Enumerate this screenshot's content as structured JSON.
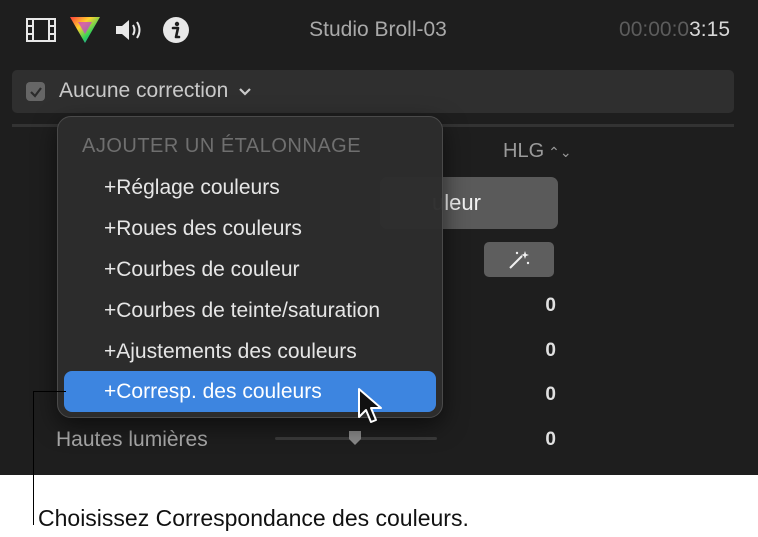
{
  "toolbar": {
    "icons": [
      "film-icon",
      "color-inspector-icon",
      "audio-icon",
      "info-icon"
    ],
    "clip_title": "Studio Broll-03",
    "timecode_dim": "00:00:0",
    "timecode_bright": "3:15"
  },
  "correction": {
    "checked": true,
    "label": "Aucune correction"
  },
  "background": {
    "hlg_label": "HLG",
    "couleur_button_label": "uleur",
    "values": [
      "0",
      "0",
      "0",
      "0"
    ],
    "highlights_label": "Hautes lumières",
    "highlights_slider": 0.5
  },
  "menu": {
    "header": "AJOUTER UN ÉTALONNAGE",
    "items": [
      "+Réglage couleurs",
      "+Roues des couleurs",
      "+Courbes de couleur",
      "+Courbes de teinte/saturation",
      "+Ajustements des couleurs",
      "+Corresp. des couleurs"
    ],
    "selected_index": 5
  },
  "caption": "Choisissez Correspondance des couleurs.",
  "colors": {
    "panel_bg": "#1e1e1e",
    "menu_highlight": "#3d85e0"
  }
}
